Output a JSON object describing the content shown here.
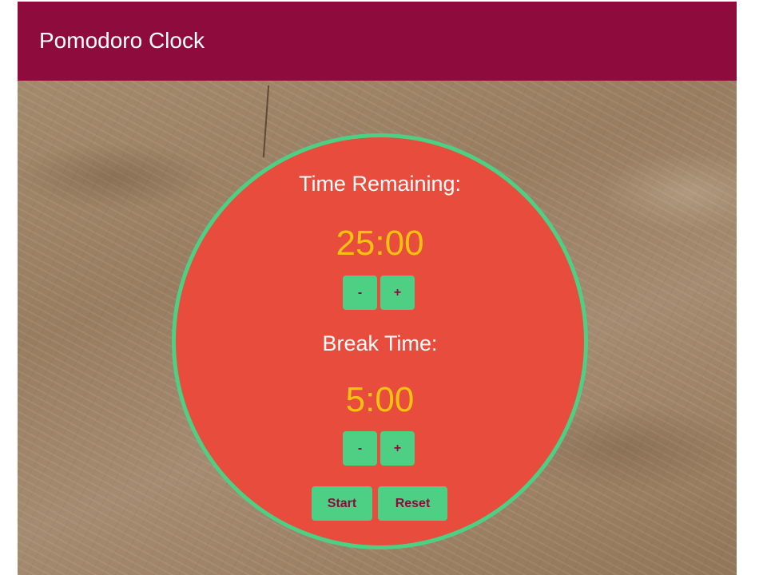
{
  "header": {
    "title": "Pomodoro Clock"
  },
  "clock": {
    "session": {
      "label": "Time Remaining:",
      "time": "25:00",
      "decrement_label": "-",
      "increment_label": "+"
    },
    "break": {
      "label": "Break Time:",
      "time": "5:00",
      "decrement_label": "-",
      "increment_label": "+"
    },
    "controls": {
      "start_label": "Start",
      "reset_label": "Reset"
    }
  },
  "colors": {
    "header_bg": "#8e0b3d",
    "clock_face": "#e74c3c",
    "clock_border": "#4dcf84",
    "time_text": "#f7c10f",
    "button_bg": "#4dcf84",
    "button_text": "#8e0b3d"
  }
}
